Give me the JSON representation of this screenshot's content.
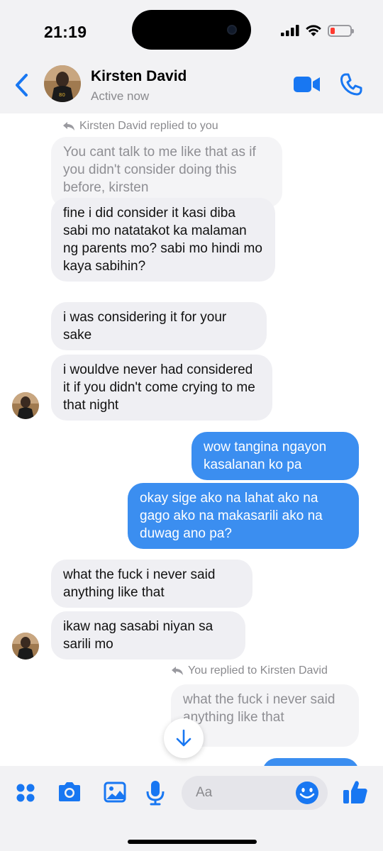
{
  "status_bar": {
    "time": "21:19",
    "icons": [
      "signal-icon",
      "wifi-icon",
      "battery-low-icon"
    ]
  },
  "header": {
    "contact_name": "Kirsten David",
    "status": "Active now",
    "icons": [
      "back-icon",
      "video-call-icon",
      "phone-call-icon"
    ]
  },
  "colors": {
    "accent": "#1877f2",
    "outgoing_bubble": "#3b8ef0",
    "incoming_bubble": "#efeff3",
    "battery_low": "#ff3b30"
  },
  "messages": [
    {
      "type": "reply_label",
      "text": "Kirsten David replied to you"
    },
    {
      "type": "quoted",
      "text": "You cant talk to me like that as if you didn't consider doing this before, kirsten"
    },
    {
      "type": "incoming",
      "text": "fine i did consider it kasi diba sabi mo natatakot ka malaman ng parents mo? sabi mo hindi mo kaya sabihin?"
    },
    {
      "type": "incoming",
      "text": "i was considering it for your sake"
    },
    {
      "type": "incoming",
      "text": "i wouldve never had considered it if you didn't come crying to me that night"
    },
    {
      "type": "outgoing",
      "text": "wow tangina ngayon kasalanan ko pa"
    },
    {
      "type": "outgoing",
      "text": "okay sige ako na lahat ako na gago ako na makasarili ako na duwag ano pa?"
    },
    {
      "type": "incoming",
      "text": "what the fuck i never said anything like that"
    },
    {
      "type": "incoming",
      "text": "ikaw nag sasabi niyan sa sarili mo"
    },
    {
      "type": "reply_label",
      "text": "You replied to Kirsten David"
    },
    {
      "type": "quoted",
      "text": "what the fuck i never said anything like that"
    }
  ],
  "composer": {
    "placeholder": "Aa",
    "icons": [
      "apps-icon",
      "camera-icon",
      "photo-icon",
      "microphone-icon",
      "emoji-icon",
      "like-icon"
    ]
  }
}
